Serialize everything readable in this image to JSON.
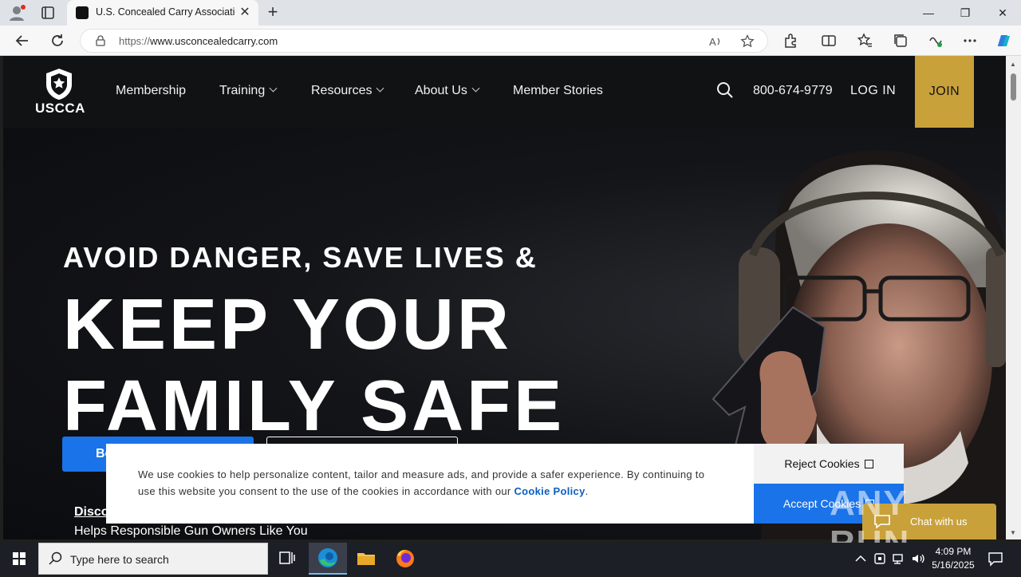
{
  "browser": {
    "tab_title": "U.S. Concealed Carry Association",
    "url_protocol": "https://",
    "url_host": "www.usconcealedcarry.com",
    "close_glyph": "✕",
    "new_tab_glyph": "+",
    "minimize_glyph": "—",
    "restore_glyph": "❐",
    "window_close_glyph": "✕"
  },
  "site": {
    "logo_text": "USCCA",
    "nav": {
      "membership": "Membership",
      "training": "Training",
      "resources": "Resources",
      "about": "About Us",
      "stories": "Member Stories"
    },
    "phone": "800-674-9779",
    "login": "LOG IN",
    "join": "JOIN",
    "accent_color": "#c9a13a"
  },
  "hero": {
    "kicker": "AVOID DANGER, SAVE LIVES &",
    "headline_line1": "KEEP YOUR",
    "headline_line2": "FAMILY SAFE",
    "primary_button_partial": "Be",
    "discover_partial": "Disco",
    "helps": "Helps Responsible Gun Owners Like You"
  },
  "cookie": {
    "message": "We use cookies to help personalize content, tailor and measure ads, and provide a safer experience. By continuing to use this website you consent to the use of the cookies in accordance with our",
    "policy_link": "Cookie Policy",
    "period": ".",
    "reject": "Reject Cookies",
    "accept": "Accept Cookies"
  },
  "chat": {
    "label": "Chat with us"
  },
  "watermark": "ANY RUN",
  "taskbar": {
    "search_placeholder": "Type here to search",
    "time": "4:09 PM",
    "date": "5/16/2025"
  }
}
